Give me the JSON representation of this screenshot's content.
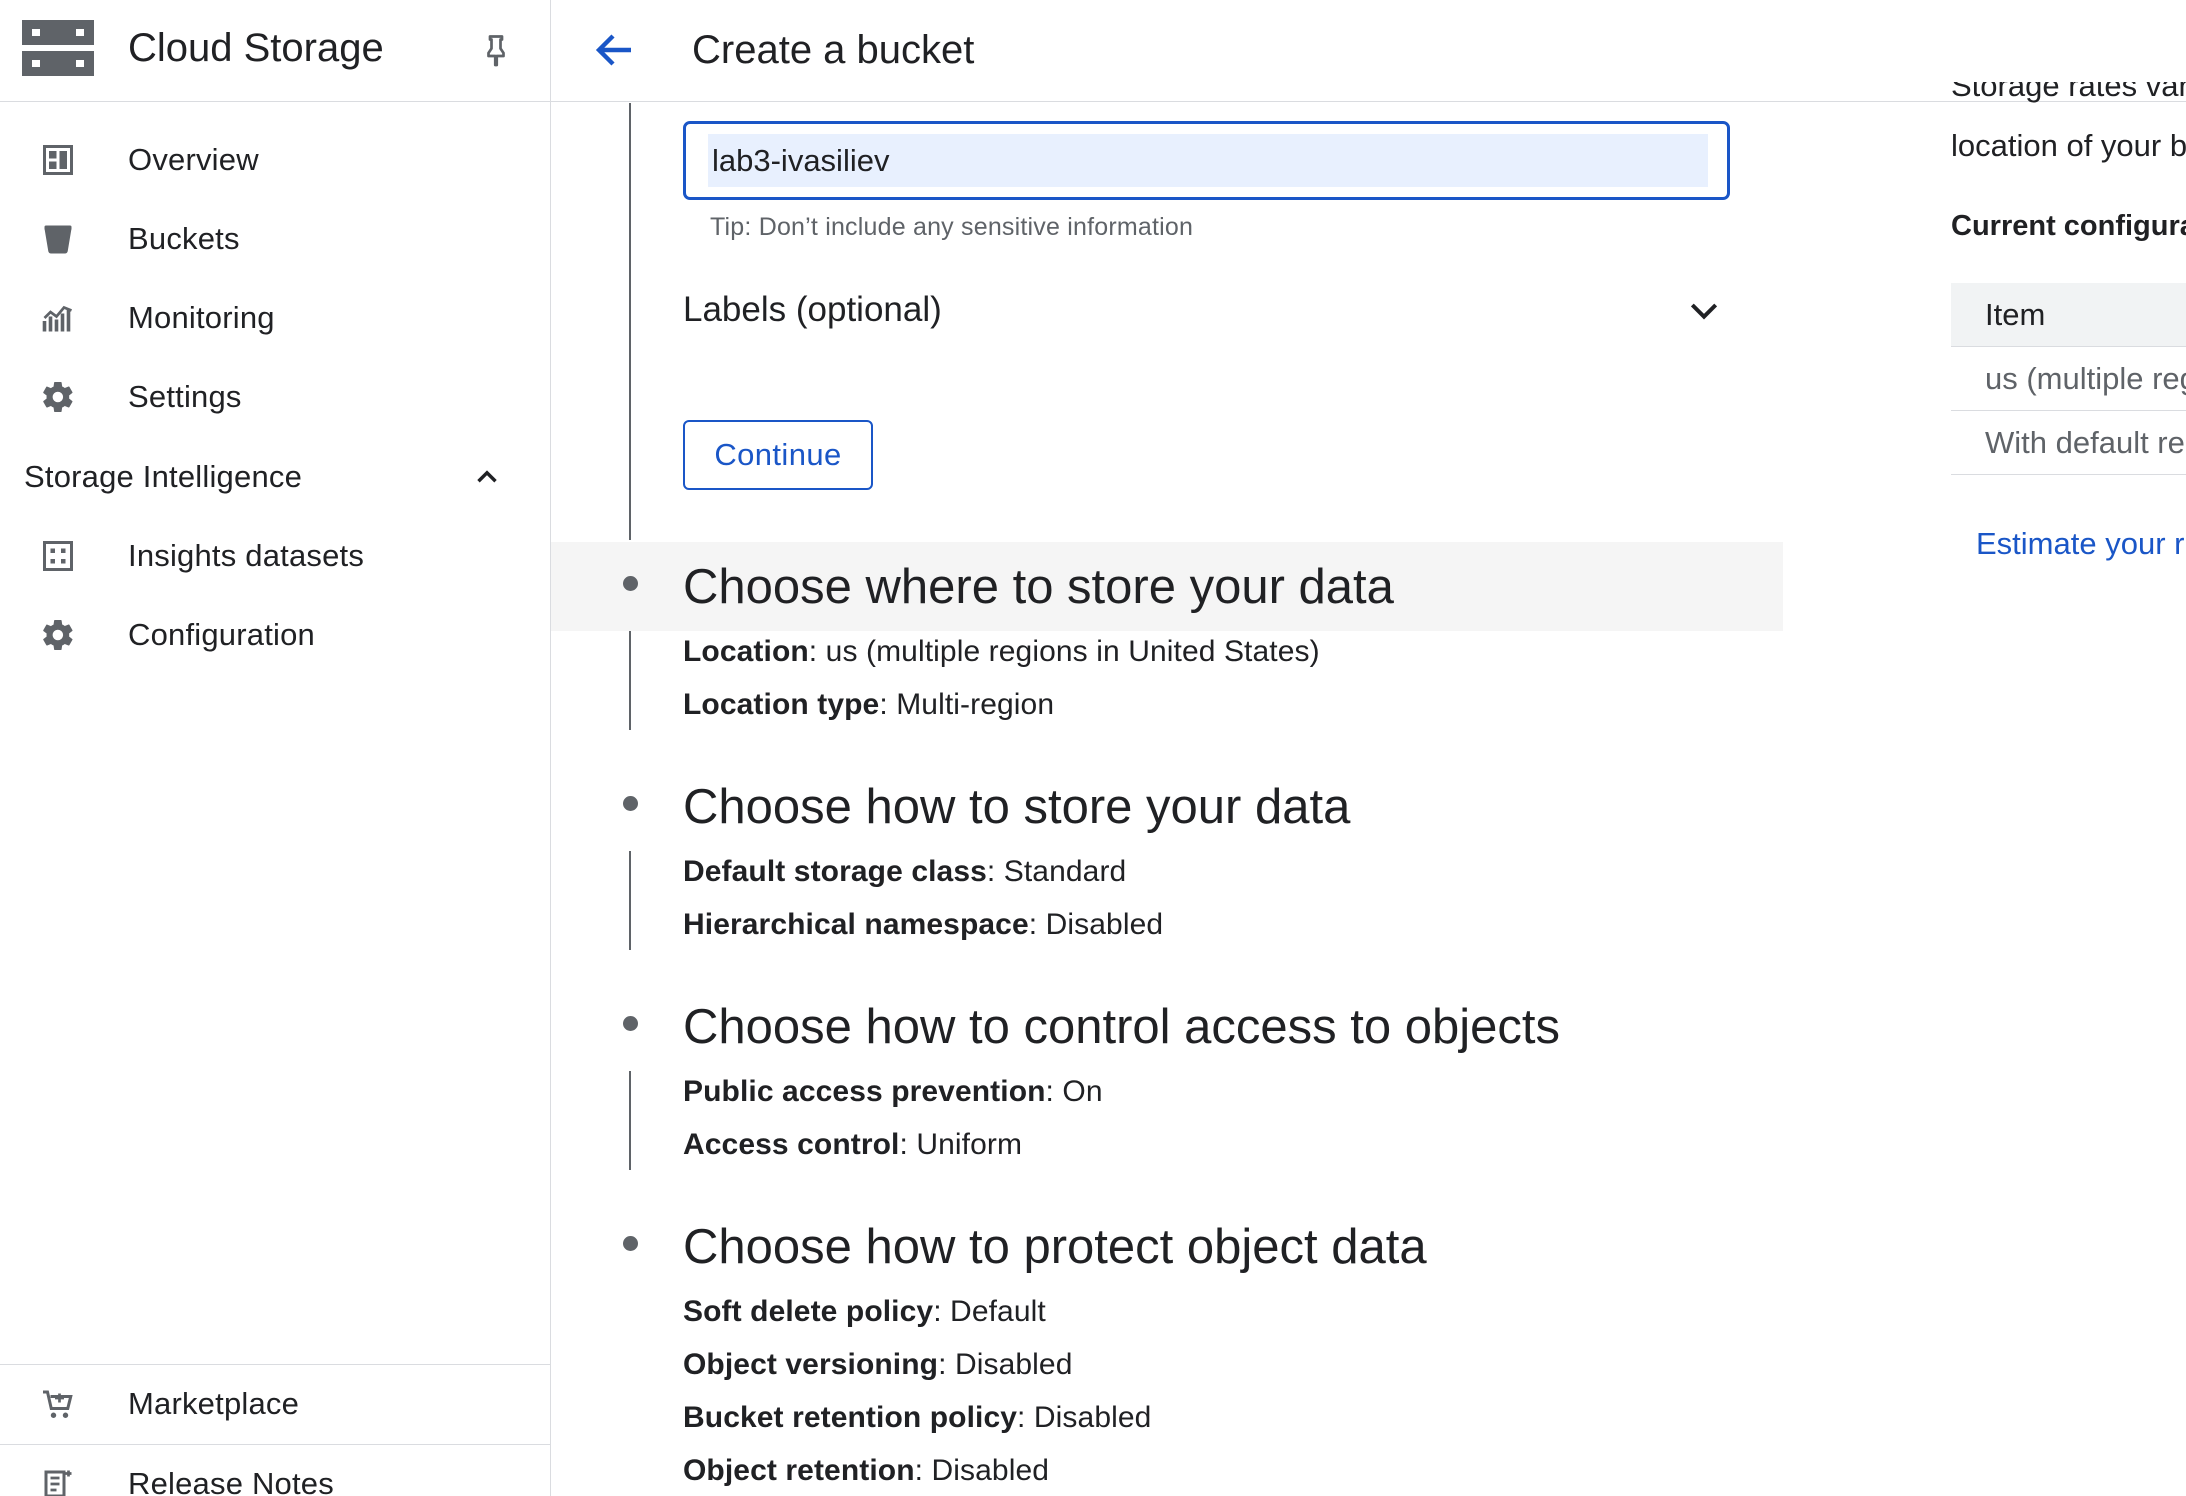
{
  "sidebar": {
    "title": "Cloud Storage",
    "items": [
      {
        "label": "Overview",
        "icon": "overview-icon"
      },
      {
        "label": "Buckets",
        "icon": "bucket-icon"
      },
      {
        "label": "Monitoring",
        "icon": "monitoring-icon"
      },
      {
        "label": "Settings",
        "icon": "gear-icon"
      }
    ],
    "section": {
      "label": "Storage Intelligence",
      "expanded": true
    },
    "section_items": [
      {
        "label": "Insights datasets",
        "icon": "insights-grid-icon"
      },
      {
        "label": "Configuration",
        "icon": "gear-icon"
      }
    ],
    "bottom_items": [
      {
        "label": "Marketplace",
        "icon": "marketplace-cart-icon"
      },
      {
        "label": "Release Notes",
        "icon": "release-notes-icon"
      }
    ]
  },
  "header": {
    "title": "Create a bucket"
  },
  "form": {
    "bucket_name_value": "lab3-ivasiliev",
    "tip": "Tip: Don’t include any sensitive information",
    "labels_label": "Labels (optional)",
    "continue_label": "Continue"
  },
  "steps": [
    {
      "title": "Choose where to store your data",
      "details": [
        {
          "key": "Location",
          "value": ": us (multiple regions in United States)"
        },
        {
          "key": "Location type",
          "value": ": Multi-region"
        }
      ]
    },
    {
      "title": "Choose how to store your data",
      "details": [
        {
          "key": "Default storage class",
          "value": ": Standard"
        },
        {
          "key": "Hierarchical namespace",
          "value": ": Disabled"
        }
      ]
    },
    {
      "title": "Choose how to control access to objects",
      "details": [
        {
          "key": "Public access prevention",
          "value": ": On"
        },
        {
          "key": "Access control",
          "value": ": Uniform"
        }
      ]
    },
    {
      "title": "Choose how to protect object data",
      "details": [
        {
          "key": "Soft delete policy",
          "value": ": Default"
        },
        {
          "key": "Object versioning",
          "value": ": Disabled"
        },
        {
          "key": "Bucket retention policy",
          "value": ": Disabled"
        },
        {
          "key": "Object retention",
          "value": ": Disabled"
        }
      ]
    }
  ],
  "right_panel": {
    "partial_line_1": "Storage rates vary",
    "partial_line_2": "location of your b",
    "heading": "Current configura",
    "table_header": "Item",
    "rows": [
      "us (multiple reg",
      "With default re"
    ],
    "link": "Estimate your r"
  },
  "colors": {
    "accent": "#1a56c7",
    "input_fill": "#e8f0fe",
    "divider": "#dadce0",
    "icon_gray": "#5f6368",
    "highlight": "#f5f5f5"
  }
}
